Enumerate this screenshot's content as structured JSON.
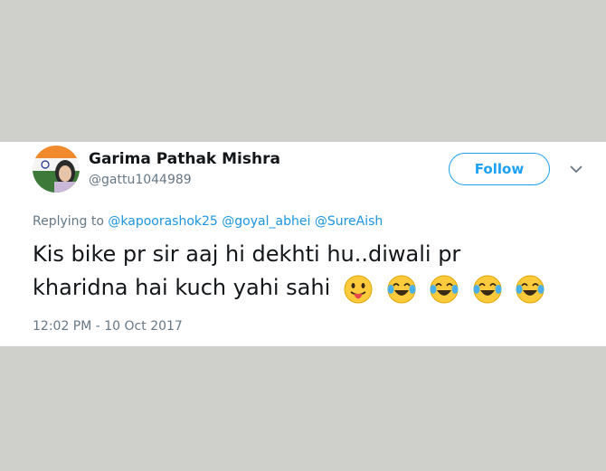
{
  "tweet": {
    "display_name": "Garima Pathak Mishra",
    "handle": "@gattu1044989",
    "follow_label": "Follow",
    "replying_label": "Replying to",
    "mentions": [
      "@kapoorashok25",
      "@goyal_abhei",
      "@SureAish"
    ],
    "text_line1": "Kis bike pr sir aaj hi dekhti hu..diwali pr",
    "text_line2": "kharidna hai kuch yahi sahi",
    "emojis": [
      "face-with-tongue-icon",
      "tears-of-joy-icon",
      "tears-of-joy-icon",
      "tears-of-joy-icon",
      "tears-of-joy-icon"
    ],
    "timestamp": "12:02 PM - 10 Oct 2017",
    "accent_color": "#1da1f2"
  }
}
